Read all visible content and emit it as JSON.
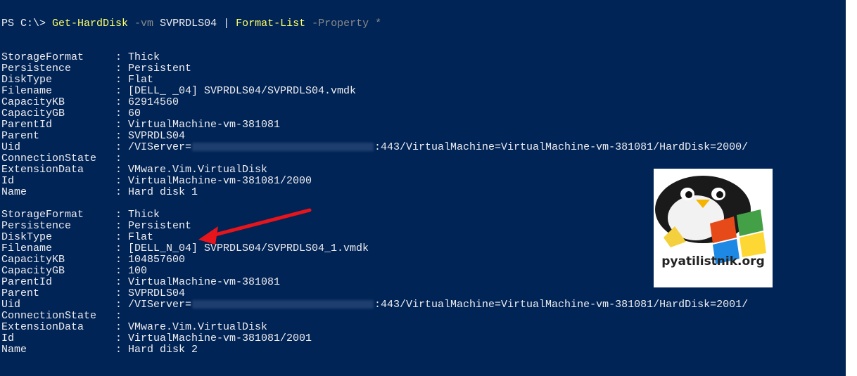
{
  "prompt": {
    "ps": "PS C:\\> ",
    "cmd1": "Get-HardDisk",
    "param1": " -vm",
    "arg1": " SVPRDLS04",
    "pipe": " | ",
    "cmd2": "Format-List",
    "param2": " -Property *"
  },
  "records": [
    {
      "rows": [
        {
          "key": "StorageFormat",
          "value": "Thick"
        },
        {
          "key": "Persistence",
          "value": "Persistent"
        },
        {
          "key": "DiskType",
          "value": "Flat"
        },
        {
          "key": "Filename",
          "value": "[DELL_ _04] SVPRDLS04/SVPRDLS04.vmdk"
        },
        {
          "key": "CapacityKB",
          "value": "62914560"
        },
        {
          "key": "CapacityGB",
          "value": "60"
        },
        {
          "key": "ParentId",
          "value": "VirtualMachine-vm-381081"
        },
        {
          "key": "Parent",
          "value": "SVPRDLS04"
        },
        {
          "key": "Uid",
          "value_prefix": "/VIServer=",
          "value_suffix": ":443/VirtualMachine=VirtualMachine-vm-381081/HardDisk=2000/"
        },
        {
          "key": "ConnectionState",
          "value": ""
        },
        {
          "key": "ExtensionData",
          "value": "VMware.Vim.VirtualDisk"
        },
        {
          "key": "Id",
          "value": "VirtualMachine-vm-381081/2000"
        },
        {
          "key": "Name",
          "value": "Hard disk 1"
        }
      ]
    },
    {
      "rows": [
        {
          "key": "StorageFormat",
          "value": "Thick"
        },
        {
          "key": "Persistence",
          "value": "Persistent"
        },
        {
          "key": "DiskType",
          "value": "Flat"
        },
        {
          "key": "Filename",
          "value": "[DELL_N_04] SVPRDLS04/SVPRDLS04_1.vmdk"
        },
        {
          "key": "CapacityKB",
          "value": "104857600"
        },
        {
          "key": "CapacityGB",
          "value": "100"
        },
        {
          "key": "ParentId",
          "value": "VirtualMachine-vm-381081"
        },
        {
          "key": "Parent",
          "value": "SVPRDLS04"
        },
        {
          "key": "Uid",
          "value_prefix": "/VIServer=",
          "value_suffix": ":443/VirtualMachine=VirtualMachine-vm-381081/HardDisk=2001/"
        },
        {
          "key": "ConnectionState",
          "value": ""
        },
        {
          "key": "ExtensionData",
          "value": "VMware.Vim.VirtualDisk"
        },
        {
          "key": "Id",
          "value": "VirtualMachine-vm-381081/2001"
        },
        {
          "key": "Name",
          "value": "Hard disk 2"
        }
      ]
    }
  ],
  "separator": ": ",
  "logo": {
    "text": "pyatilistnik.org"
  },
  "colors": {
    "console_bg": "#012456",
    "console_text": "#eeedf0",
    "cmdlet": "#ffff66",
    "parameter": "#8a8a8a",
    "arrow": "#e8141c"
  }
}
